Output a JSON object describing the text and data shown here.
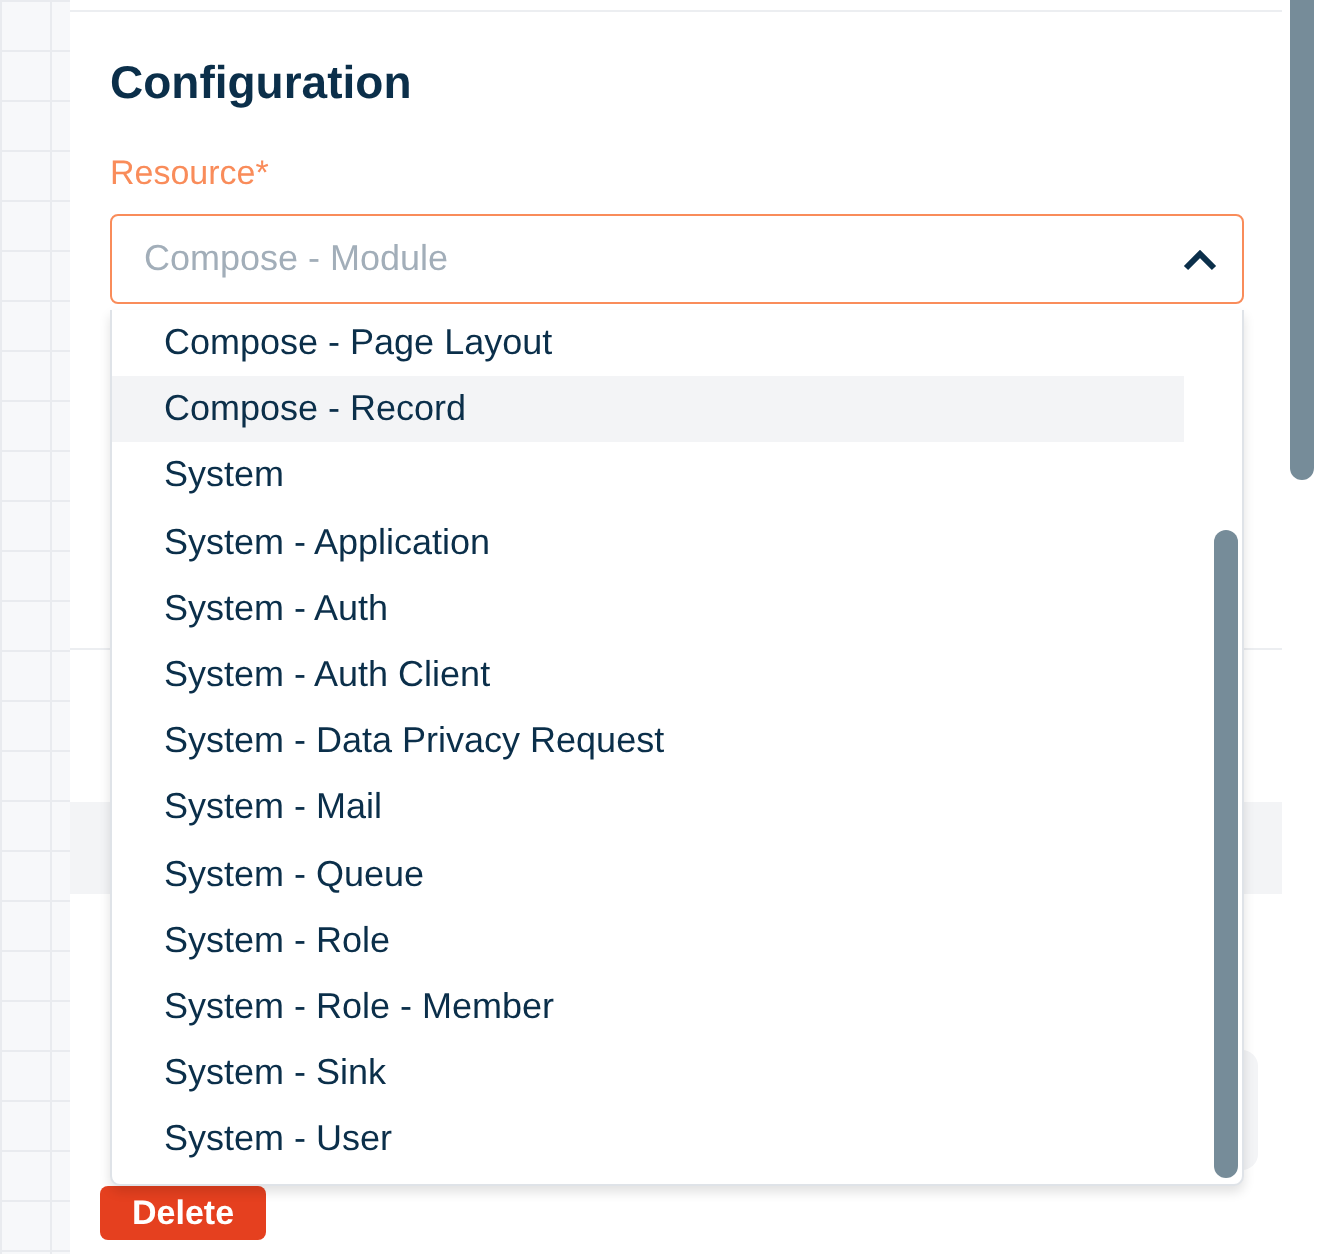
{
  "heading": "Configuration",
  "resource": {
    "label": "Resource*",
    "value": "Compose - Module",
    "expanded": true,
    "options": [
      {
        "label": "Compose - Page Layout",
        "selected": false
      },
      {
        "label": "Compose - Record",
        "selected": true
      },
      {
        "label": "System",
        "selected": false
      },
      {
        "label": "System - Application",
        "selected": false
      },
      {
        "label": "System - Auth",
        "selected": false
      },
      {
        "label": "System - Auth Client",
        "selected": false
      },
      {
        "label": "System - Data Privacy Request",
        "selected": false
      },
      {
        "label": "System - Mail",
        "selected": false
      },
      {
        "label": "System - Queue",
        "selected": false
      },
      {
        "label": "System - Role",
        "selected": false
      },
      {
        "label": "System - Role - Member",
        "selected": false
      },
      {
        "label": "System - Sink",
        "selected": false
      },
      {
        "label": "System - User",
        "selected": false
      }
    ]
  },
  "delete_button": "Delete"
}
